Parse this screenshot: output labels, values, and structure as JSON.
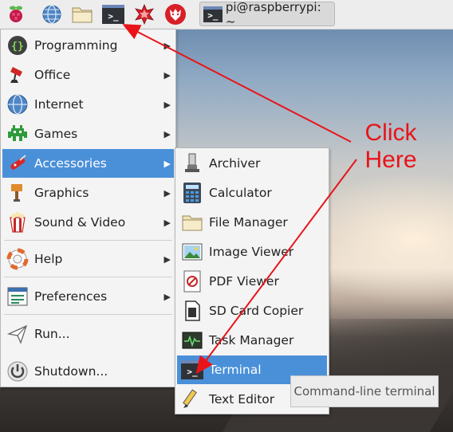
{
  "panel": {
    "task_title": "pi@raspberrypi: ~",
    "launchers": [
      "raspberry-menu-icon",
      "web-browser-icon",
      "file-manager-icon",
      "terminal-icon",
      "mathematica-icon",
      "wolfram-icon"
    ]
  },
  "main_menu": {
    "items": [
      {
        "label": "Programming",
        "icon": "programming-icon",
        "submenu": true
      },
      {
        "label": "Office",
        "icon": "office-icon",
        "submenu": true
      },
      {
        "label": "Internet",
        "icon": "internet-icon",
        "submenu": true
      },
      {
        "label": "Games",
        "icon": "games-icon",
        "submenu": true
      },
      {
        "label": "Accessories",
        "icon": "accessories-icon",
        "submenu": true,
        "active": true
      },
      {
        "label": "Graphics",
        "icon": "graphics-icon",
        "submenu": true
      },
      {
        "label": "Sound & Video",
        "icon": "sound-video-icon",
        "submenu": true
      },
      {
        "label": "Help",
        "icon": "help-icon",
        "submenu": true
      },
      {
        "label": "Preferences",
        "icon": "preferences-icon",
        "submenu": true
      },
      {
        "label": "Run...",
        "icon": "run-icon",
        "submenu": false
      },
      {
        "label": "Shutdown...",
        "icon": "shutdown-icon",
        "submenu": false
      }
    ]
  },
  "sub_menu": {
    "items": [
      {
        "label": "Archiver",
        "icon": "archiver-icon"
      },
      {
        "label": "Calculator",
        "icon": "calculator-icon"
      },
      {
        "label": "File Manager",
        "icon": "file-manager-icon"
      },
      {
        "label": "Image Viewer",
        "icon": "image-viewer-icon"
      },
      {
        "label": "PDF Viewer",
        "icon": "pdf-viewer-icon"
      },
      {
        "label": "SD Card Copier",
        "icon": "sd-card-copier-icon"
      },
      {
        "label": "Task Manager",
        "icon": "task-manager-icon"
      },
      {
        "label": "Terminal",
        "icon": "terminal-icon",
        "active": true
      },
      {
        "label": "Text Editor",
        "icon": "text-editor-icon"
      }
    ]
  },
  "tooltip": "Command-line terminal",
  "callout": {
    "line1": "Click",
    "line2": "Here",
    "color": "#e8141a"
  },
  "colors": {
    "highlight": "#4a90d9",
    "annotation": "#e8141a"
  }
}
